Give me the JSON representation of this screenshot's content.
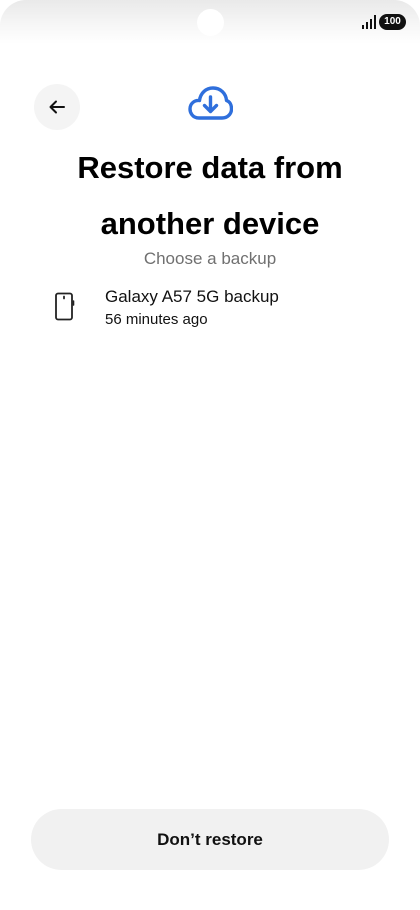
{
  "status_bar": {
    "battery_level": "100",
    "signal_icon": "signal-bars-icon"
  },
  "header": {
    "back_icon": "arrow-left-icon",
    "hero_icon": "cloud-download-icon",
    "title": "Restore data from another device",
    "subtitle": "Choose a backup",
    "accent_color": "#2f6fdc"
  },
  "backups": [
    {
      "icon": "smartphone-icon",
      "name": "Galaxy A57 5G backup",
      "time": "56 minutes ago"
    }
  ],
  "footer": {
    "dont_restore_label": "Don’t restore"
  }
}
